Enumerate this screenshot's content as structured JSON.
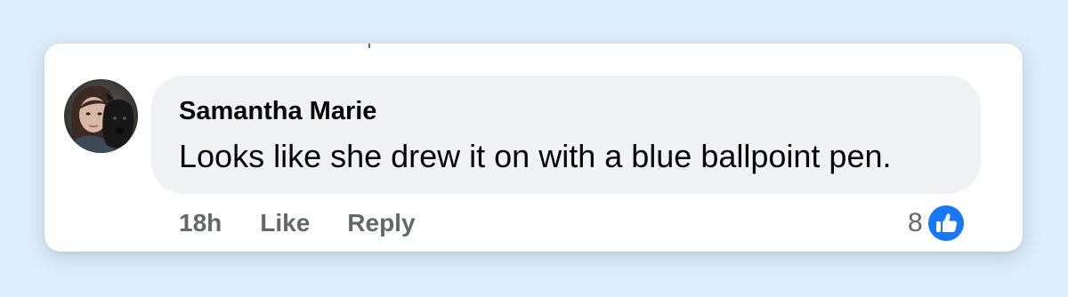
{
  "comment": {
    "author": "Samantha Marie",
    "text": "Looks like she drew it on with a blue ballpoint pen.",
    "timestamp": "18h",
    "like_label": "Like",
    "reply_label": "Reply",
    "reaction_count": "8",
    "reaction_icon": "thumbs-up-icon"
  },
  "colors": {
    "page_background": "#deeefb",
    "bubble_background": "#f0f2f5",
    "secondary_text": "#65676b",
    "like_blue": "#1877f2"
  }
}
